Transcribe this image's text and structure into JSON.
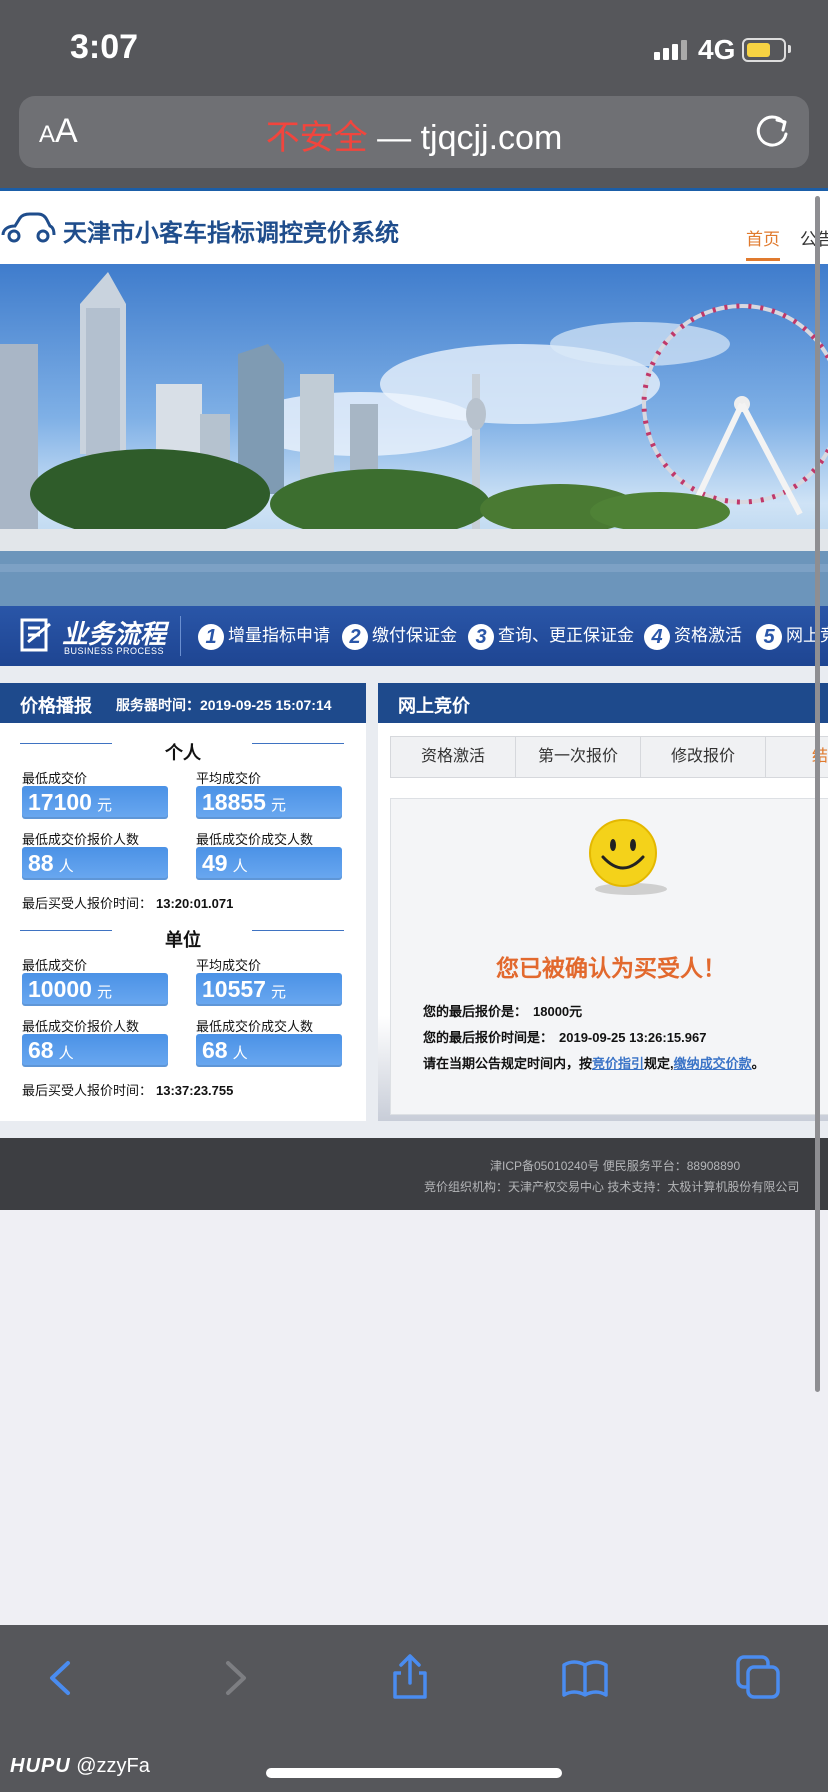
{
  "status": {
    "time": "3:07",
    "network": "4G"
  },
  "browser": {
    "aa": "AA",
    "url_insecure": "不安全",
    "url_sep": " — ",
    "url_domain": "tjqcjj.com"
  },
  "site": {
    "title": "天津市小客车指标调控竞价系统",
    "nav": {
      "home": "首页",
      "notice": "公告"
    }
  },
  "process": {
    "title": "业务流程",
    "subtitle": "BUSINESS PROCESS",
    "steps": [
      {
        "num": "1",
        "label": "增量指标申请"
      },
      {
        "num": "2",
        "label": "缴付保证金"
      },
      {
        "num": "3",
        "label": "查询、更正保证金"
      },
      {
        "num": "4",
        "label": "资格激活"
      },
      {
        "num": "5",
        "label": "网上竞"
      }
    ]
  },
  "price_panel": {
    "title": "价格播报",
    "server_time": "服务器时间：2019-09-25 15:07:14",
    "individual": {
      "title": "个人",
      "min_price_label": "最低成交价",
      "min_price": "17100",
      "avg_price_label": "平均成交价",
      "avg_price": "18855",
      "price_unit": "元",
      "min_bidders_label": "最低成交价报价人数",
      "min_bidders": "88",
      "min_winners_label": "最低成交价成交人数",
      "min_winners": "49",
      "person_unit": "人",
      "last_time_label": "最后买受人报价时间：",
      "last_time": "13:20:01.071"
    },
    "unit": {
      "title": "单位",
      "min_price_label": "最低成交价",
      "min_price": "10000",
      "avg_price_label": "平均成交价",
      "avg_price": "10557",
      "price_unit": "元",
      "min_bidders_label": "最低成交价报价人数",
      "min_bidders": "68",
      "min_winners_label": "最低成交价成交人数",
      "min_winners": "68",
      "person_unit": "人",
      "last_time_label": "最后买受人报价时间：",
      "last_time": "13:37:23.755"
    }
  },
  "auction": {
    "title": "网上竞价",
    "tabs": [
      "资格激活",
      "第一次报价",
      "修改报价",
      "结果"
    ],
    "confirm": "您已被确认为买受人！",
    "last_bid_label": "您的最后报价是：",
    "last_bid": "18000元",
    "last_bid_time_label": "您的最后报价时间是：",
    "last_bid_time": "2019-09-25 13:26:15.967",
    "notice_prefix": "请在当期公告规定时间内，按",
    "notice_link1": "竞价指引",
    "notice_mid": "规定,",
    "notice_link2": "缴纳成交价款",
    "notice_suffix": "。"
  },
  "footer": {
    "line1": "津ICP备05010240号    便民服务平台：88908890",
    "line2": "竞价组织机构：天津产权交易中心    技术支持：太极计算机股份有限公司"
  },
  "watermark": {
    "brand": "HUPU",
    "user": "@zzyFa"
  },
  "colors": {
    "header_blue": "#1e4a8c",
    "accent_orange": "#e07a2e",
    "stat_blue": "#4b92e6",
    "insecure_red": "#f2453d"
  }
}
